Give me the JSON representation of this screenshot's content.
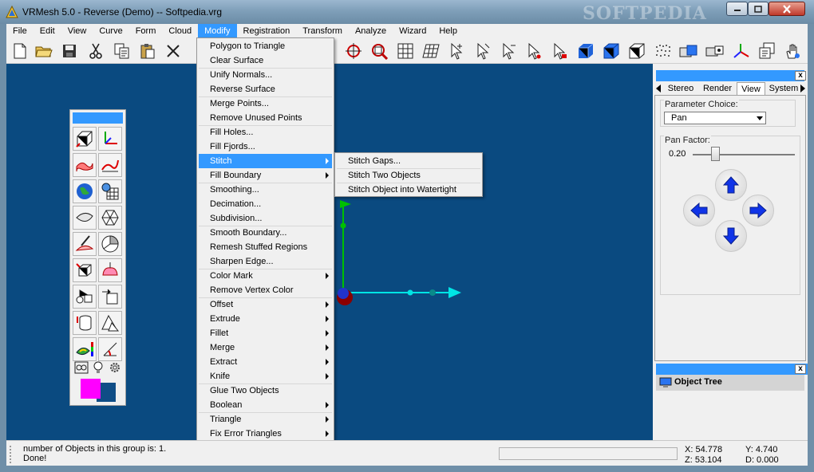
{
  "window": {
    "title": "VRMesh 5.0 - Reverse (Demo) -- Softpedia.vrg",
    "watermark": "SOFTPEDIA"
  },
  "menubar": {
    "items": [
      "File",
      "Edit",
      "View",
      "Curve",
      "Form",
      "Cloud",
      "Modify",
      "Registration",
      "Transform",
      "Analyze",
      "Wizard",
      "Help"
    ],
    "active": "Modify"
  },
  "toolbar": {
    "icons": [
      "new-file-icon",
      "open-folder-icon",
      "save-icon",
      "cut-icon",
      "copy-icon",
      "paste-icon",
      "delete-icon",
      "zoom-target-icon",
      "zoom-window-icon",
      "grid-icon",
      "perspective-grid-icon",
      "select-arrow-icon",
      "select-add-icon",
      "select-remove-icon",
      "select-node-icon",
      "select-lock-icon",
      "solid-box-icon",
      "shaded-box-icon",
      "wire-box-icon",
      "point-cloud-icon",
      "view-front-icon",
      "view-side-icon",
      "axis-icon",
      "layers-icon",
      "hand-icon"
    ]
  },
  "modify_menu": {
    "items": [
      {
        "label": "Polygon to Triangle",
        "submenu": false
      },
      {
        "label": "Clear Surface",
        "submenu": false
      },
      {
        "label": "Unify Normals...",
        "submenu": false
      },
      {
        "label": "Reverse Surface",
        "submenu": false
      },
      {
        "label": "Merge Points...",
        "submenu": false
      },
      {
        "label": "Remove Unused Points",
        "submenu": false
      },
      {
        "label": "Fill Holes...",
        "submenu": false
      },
      {
        "label": "Fill Fjords...",
        "submenu": false
      },
      {
        "label": "Stitch",
        "submenu": true
      },
      {
        "label": "Fill Boundary",
        "submenu": true
      },
      {
        "label": "Smoothing...",
        "submenu": false
      },
      {
        "label": "Decimation...",
        "submenu": false
      },
      {
        "label": "Subdivision...",
        "submenu": false
      },
      {
        "label": "Smooth Boundary...",
        "submenu": false
      },
      {
        "label": "Remesh Stuffed Regions",
        "submenu": false
      },
      {
        "label": "Sharpen Edge...",
        "submenu": false
      },
      {
        "label": "Color Mark",
        "submenu": true
      },
      {
        "label": "Remove Vertex Color",
        "submenu": false
      },
      {
        "label": "Offset",
        "submenu": true
      },
      {
        "label": "Extrude",
        "submenu": true
      },
      {
        "label": "Fillet",
        "submenu": true
      },
      {
        "label": "Merge",
        "submenu": true
      },
      {
        "label": "Extract",
        "submenu": true
      },
      {
        "label": "Knife",
        "submenu": true
      },
      {
        "label": "Glue Two Objects",
        "submenu": false
      },
      {
        "label": "Boolean",
        "submenu": true
      },
      {
        "label": "Triangle",
        "submenu": true
      },
      {
        "label": "Fix Error Triangles",
        "submenu": true
      }
    ],
    "highlighted": "Stitch"
  },
  "stitch_submenu": {
    "items": [
      "Stitch Gaps...",
      "Stitch Two Objects",
      "Stitch Object into Watertight"
    ]
  },
  "right_panel": {
    "tabs": [
      "Stereo",
      "Render",
      "View",
      "System"
    ],
    "selected_tab": "View",
    "parameter_choice_label": "Parameter Choice:",
    "parameter_choice_value": "Pan",
    "pan_factor_label": "Pan Factor:",
    "pan_factor_value": "0.20",
    "pan_factor_fraction": 0.2,
    "close_glyph": "x"
  },
  "object_tree": {
    "title": "Object Tree"
  },
  "status": {
    "line1": "number of Objects in this group is: 1.",
    "line2": "Done!",
    "x": "X: 54.778",
    "y": "Y: 4.740",
    "z": "Z: 53.104",
    "d": "D: 0.000"
  },
  "colors": {
    "viewport_bg": "#0a4a80",
    "highlight": "#3399ff",
    "axis_x": "#00e5e5",
    "axis_y": "#00c000",
    "swatch_primary": "#ff00ff"
  }
}
